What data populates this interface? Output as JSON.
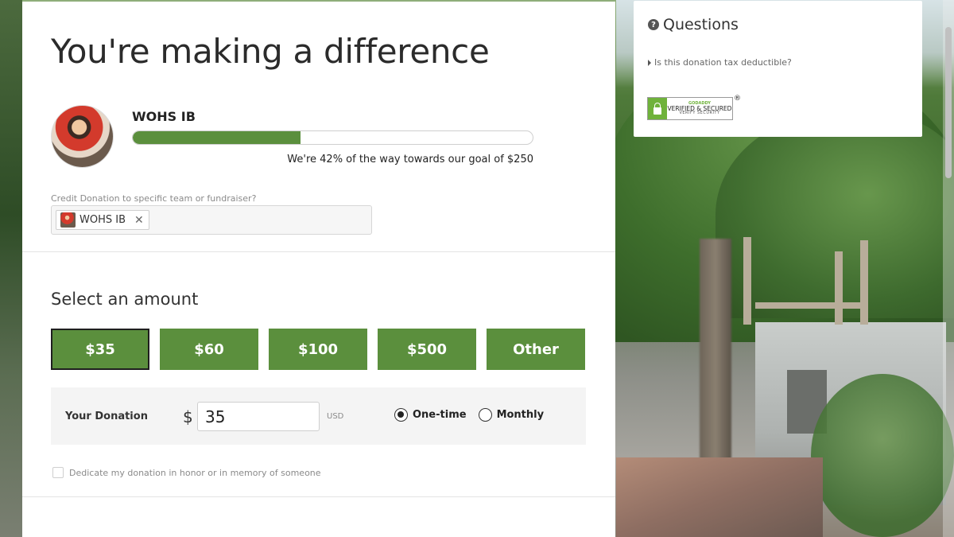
{
  "main": {
    "headline": "You're making a difference",
    "team_name": "WOHS IB",
    "progress_percent": 42,
    "progress_text": "We're 42% of the way towards our goal of $250",
    "credit_label": "Credit Donation to specific team or fundraiser?",
    "credit_chip_label": "WOHS IB",
    "chip_close_glyph": "✕",
    "select_amount_title": "Select an amount",
    "amount_options": [
      {
        "label": "$35",
        "selected": true
      },
      {
        "label": "$60",
        "selected": false
      },
      {
        "label": "$100",
        "selected": false
      },
      {
        "label": "$500",
        "selected": false
      },
      {
        "label": "Other",
        "selected": false
      }
    ],
    "your_donation_label": "Your Donation",
    "currency_symbol": "$",
    "donation_amount": "35",
    "currency_code": "USD",
    "frequency_options": [
      {
        "label": "One-time",
        "selected": true
      },
      {
        "label": "Monthly",
        "selected": false
      }
    ],
    "dedicate_label": "Dedicate my donation in honor or in memory of someone"
  },
  "questions": {
    "title": "Questions",
    "icon_glyph": "?",
    "link": "Is this donation tax deductible?",
    "badge": {
      "line1": "GODADDY",
      "line2": "VERIFIED & SECURED",
      "line3": "VERIFY SECURITY",
      "registered": "®"
    }
  },
  "colors": {
    "brand_green": "#5b8f3d",
    "selected_border": "#1f1f1f"
  }
}
